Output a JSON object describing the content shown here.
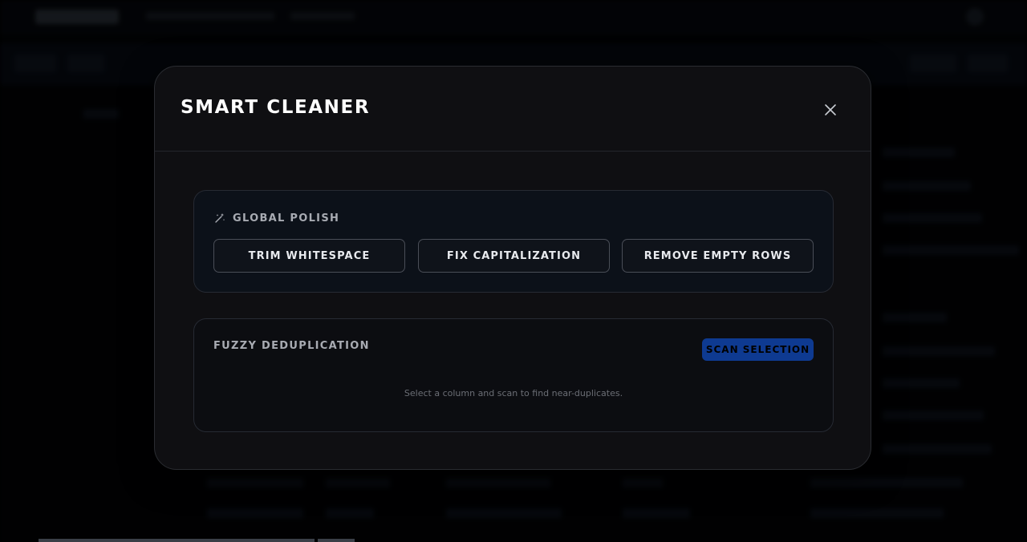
{
  "modal": {
    "title": "SMART CLEANER",
    "close_icon": "close-icon"
  },
  "global_polish": {
    "label": "GLOBAL POLISH",
    "icon": "magic-wand-icon",
    "buttons": [
      {
        "label": "TRIM WHITESPACE"
      },
      {
        "label": "FIX CAPITALIZATION"
      },
      {
        "label": "REMOVE EMPTY ROWS"
      }
    ]
  },
  "fuzzy_dedup": {
    "label": "FUZZY DEDUPLICATION",
    "scan_button": "SCAN SELECTION",
    "hint": "Select a column and scan to find near-duplicates."
  },
  "colors": {
    "modal_bg": "#0f0f12",
    "accent": "#0e3a91",
    "text_primary": "#ffffff",
    "text_muted": "#a8abb2"
  }
}
